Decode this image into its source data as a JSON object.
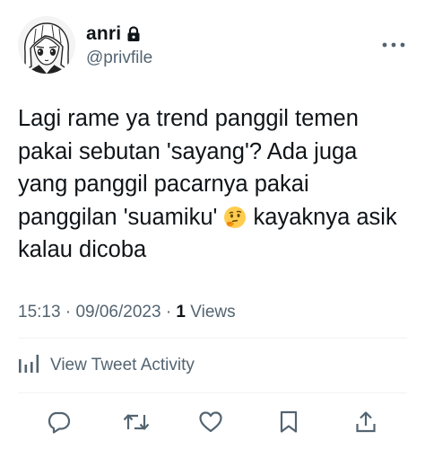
{
  "user": {
    "display_name": "anri",
    "handle": "@privfile",
    "protected": true,
    "avatar_icon": "anime-girl-avatar"
  },
  "tweet": {
    "text_before_emoji": "Lagi rame ya trend panggil temen pakai sebutan 'sayang'? Ada juga yang panggil pacarnya pakai panggilan 'suamiku' ",
    "emoji_icon": "thinking-face-emoji",
    "text_after_emoji": " kayaknya asik kalau dicoba",
    "time": "15:13",
    "date": "09/06/2023",
    "separator": "·",
    "views_count": "1",
    "views_label": "Views"
  },
  "activity": {
    "label": "View Tweet Activity",
    "icon": "bar-chart-icon"
  },
  "actions": {
    "reply_icon": "reply-icon",
    "retweet_icon": "retweet-icon",
    "like_icon": "heart-icon",
    "bookmark_icon": "bookmark-icon",
    "share_icon": "share-icon"
  },
  "colors": {
    "text": "#0f1419",
    "secondary": "#536471",
    "divider": "#eff3f4",
    "emoji": "#ffcc4d"
  }
}
